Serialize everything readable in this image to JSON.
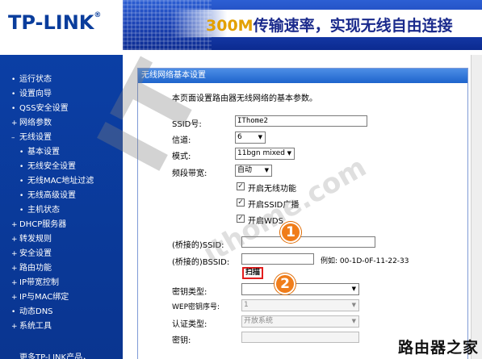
{
  "header": {
    "logo": "TP-LINK",
    "logo_reg": "®",
    "slogan_num": "300M",
    "slogan_text": "传输速率，实现无线自由连接"
  },
  "sidebar": {
    "items": [
      {
        "label": "运行状态",
        "bullet": "•",
        "sub": false
      },
      {
        "label": "设置向导",
        "bullet": "•",
        "sub": false
      },
      {
        "label": "QSS安全设置",
        "bullet": "•",
        "sub": false
      },
      {
        "label": "网络参数",
        "bullet": "+",
        "sub": false
      },
      {
        "label": "无线设置",
        "bullet": "–",
        "sub": false
      },
      {
        "label": "基本设置",
        "bullet": "•",
        "sub": true
      },
      {
        "label": "无线安全设置",
        "bullet": "•",
        "sub": true
      },
      {
        "label": "无线MAC地址过滤",
        "bullet": "•",
        "sub": true
      },
      {
        "label": "无线高级设置",
        "bullet": "•",
        "sub": true
      },
      {
        "label": "主机状态",
        "bullet": "•",
        "sub": true
      },
      {
        "label": "DHCP服务器",
        "bullet": "+",
        "sub": false
      },
      {
        "label": "转发规则",
        "bullet": "+",
        "sub": false
      },
      {
        "label": "安全设置",
        "bullet": "+",
        "sub": false
      },
      {
        "label": "路由功能",
        "bullet": "+",
        "sub": false
      },
      {
        "label": "IP带宽控制",
        "bullet": "+",
        "sub": false
      },
      {
        "label": "IP与MAC绑定",
        "bullet": "+",
        "sub": false
      },
      {
        "label": "动态DNS",
        "bullet": "•",
        "sub": false
      },
      {
        "label": "系统工具",
        "bullet": "+",
        "sub": false
      }
    ],
    "more_link": "更多TP-LINK产品，"
  },
  "panel": {
    "title": "无线网络基本设置",
    "intro": "本页面设置路由器无线网络的基本参数。",
    "ssid_label": "SSID号:",
    "ssid_value": "IThome2",
    "channel_label": "信道:",
    "channel_value": "6",
    "mode_label": "模式:",
    "mode_value": "11bgn mixed",
    "bandwidth_label": "频段带宽:",
    "bandwidth_value": "自动",
    "enable_wireless": "开启无线功能",
    "enable_ssid_broadcast": "开启SSID广播",
    "enable_wds": "开启WDS",
    "bridged_ssid_label": "(桥接的)SSID:",
    "bridged_ssid_value": "",
    "bridged_bssid_label": "(桥接的)BSSID:",
    "bridged_bssid_value": "",
    "bssid_example": "例如: 00-1D-0F-11-22-33",
    "scan_button": "扫描",
    "key_type_label": "密钥类型:",
    "key_type_value": "",
    "wep_index_label": "WEP密钥序号:",
    "wep_index_value": "1",
    "auth_type_label": "认证类型:",
    "auth_type_value": "开放系统",
    "key_label": "密钥:",
    "key_value": ""
  },
  "callouts": {
    "first": "1",
    "second": "2"
  },
  "watermark": {
    "it": "IT",
    "url": "ithome.com"
  },
  "bottom_mark": "路由器之家"
}
